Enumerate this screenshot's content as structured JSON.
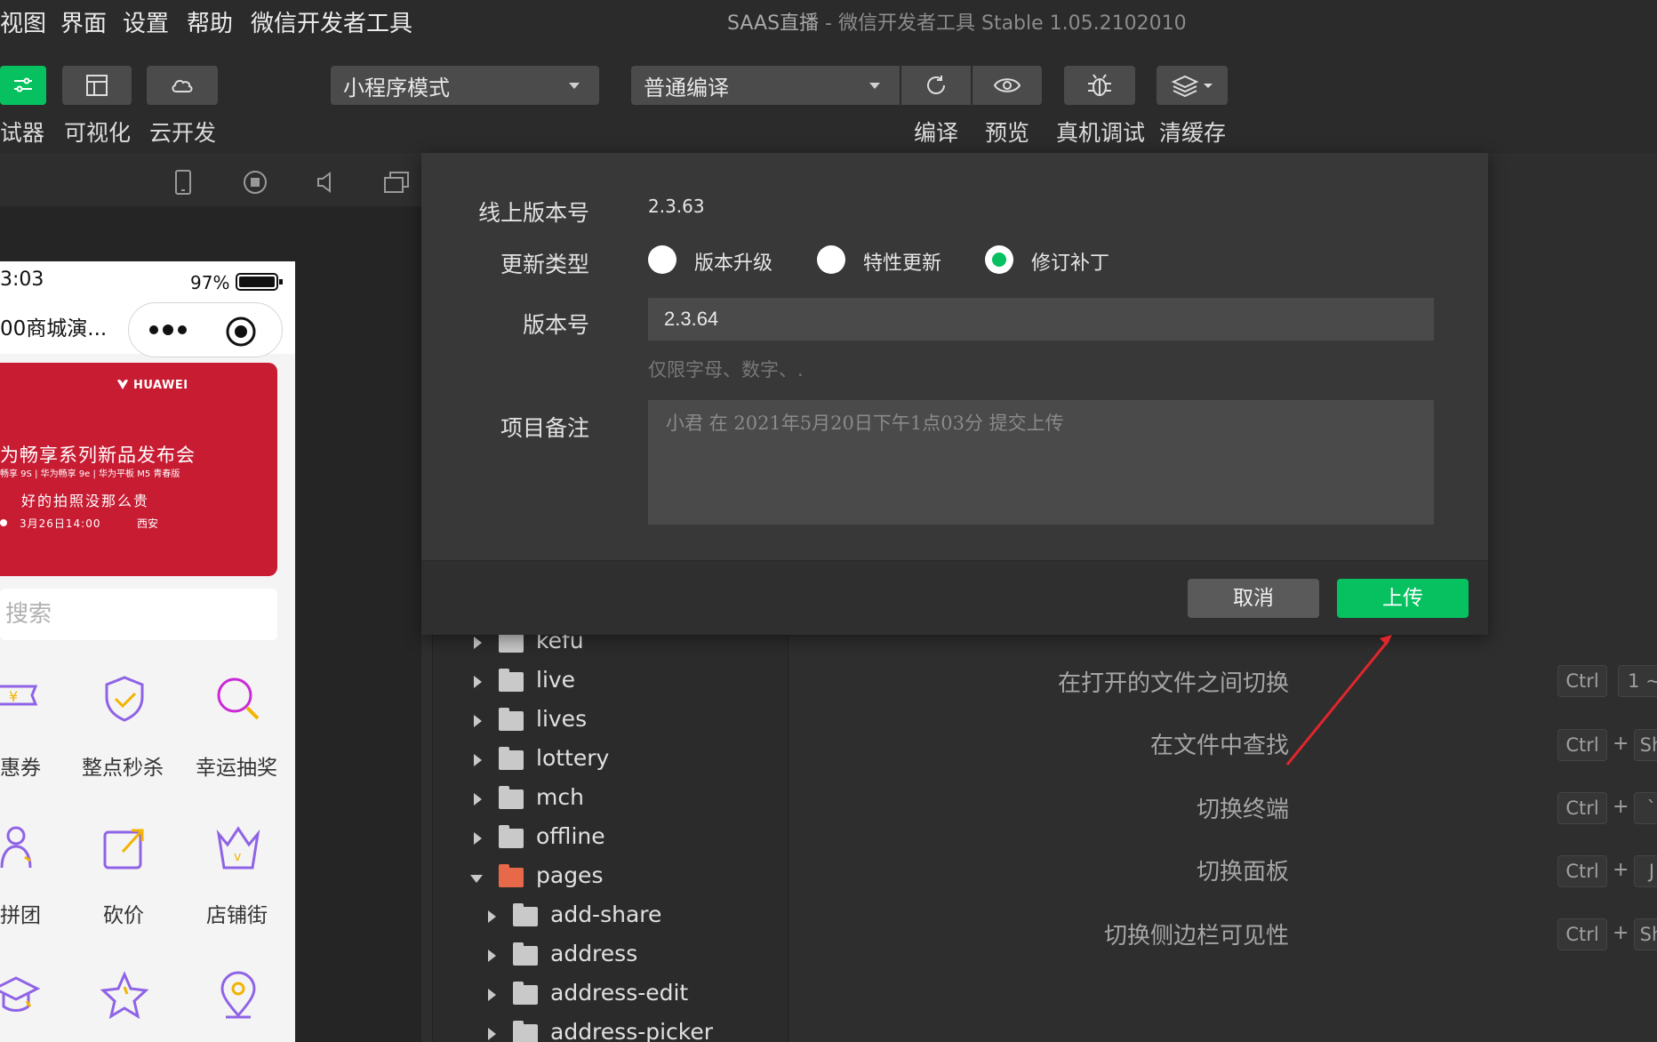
{
  "menu": {
    "items": [
      "视图",
      "界面",
      "设置",
      "帮助",
      "微信开发者工具"
    ],
    "window_title_app": "SAAS直播",
    "window_title_rest": " - 微信开发者工具 Stable 1.05.2102010"
  },
  "toolbar": {
    "simulator_label": "试器",
    "visual_label": "可视化",
    "cloud_label": "云开发",
    "mode_select": "小程序模式",
    "compile_select": "普通编译",
    "compile_label": "编译",
    "preview_label": "预览",
    "debug_label": "真机调试",
    "clear_cache_label": "清缓存"
  },
  "phone": {
    "time": "3:03",
    "battery": "97%",
    "page_title": "00商城演...",
    "banner": {
      "brand": "HUAWEI",
      "headline": "为畅享系列新品发布会",
      "models": "畅享 9S | 华为畅享 9e | 华为平板 M5 青春版",
      "slogan": "好的拍照没那么贵",
      "date": "3月26日14:00",
      "city": "西安"
    },
    "search_placeholder": "搜索",
    "grid": [
      {
        "label": "惠券",
        "icon": "coupon-icon"
      },
      {
        "label": "整点秒杀",
        "icon": "shield-icon"
      },
      {
        "label": "幸运抽奖",
        "icon": "magnifier-icon"
      },
      {
        "label": "拼团",
        "icon": "group-icon"
      },
      {
        "label": "砍价",
        "icon": "edit-icon"
      },
      {
        "label": "店铺街",
        "icon": "crown-icon"
      }
    ]
  },
  "tree": {
    "items": [
      {
        "name": "kefu",
        "expanded": false,
        "level": 1
      },
      {
        "name": "live",
        "expanded": false,
        "level": 1
      },
      {
        "name": "lives",
        "expanded": false,
        "level": 1
      },
      {
        "name": "lottery",
        "expanded": false,
        "level": 1
      },
      {
        "name": "mch",
        "expanded": false,
        "level": 1
      },
      {
        "name": "offline",
        "expanded": false,
        "level": 1
      },
      {
        "name": "pages",
        "expanded": true,
        "level": 1
      },
      {
        "name": "add-share",
        "expanded": false,
        "level": 2
      },
      {
        "name": "address",
        "expanded": false,
        "level": 2
      },
      {
        "name": "address-edit",
        "expanded": false,
        "level": 2
      },
      {
        "name": "address-picker",
        "expanded": false,
        "level": 2
      }
    ]
  },
  "shortcuts": [
    {
      "label": "在打开的文件之间切换",
      "keys": [
        "Ctrl",
        "1 ~"
      ]
    },
    {
      "label": "在文件中查找",
      "keys": [
        "Ctrl",
        "+",
        "Sh"
      ]
    },
    {
      "label": "切换终端",
      "keys": [
        "Ctrl",
        "+",
        "`"
      ]
    },
    {
      "label": "切换面板",
      "keys": [
        "Ctrl",
        "+",
        "J"
      ]
    },
    {
      "label": "切换侧边栏可见性",
      "keys": [
        "Ctrl",
        "+",
        "Sh"
      ]
    }
  ],
  "dialog": {
    "online_version_label": "线上版本号",
    "online_version": "2.3.63",
    "update_type_label": "更新类型",
    "update_types": [
      "版本升级",
      "特性更新",
      "修订补丁"
    ],
    "selected_update_type": "修订补丁",
    "version_label": "版本号",
    "version_value": "2.3.64",
    "version_hint": "仅限字母、数字、.",
    "remark_label": "项目备注",
    "remark_placeholder": "小君  在  2021年5月20日下午1点03分  提交上传",
    "cancel_label": "取消",
    "upload_label": "上传"
  },
  "colors": {
    "accent_green": "#07c160",
    "annotation_red": "#e0262b",
    "banner_red": "#c81c33"
  }
}
